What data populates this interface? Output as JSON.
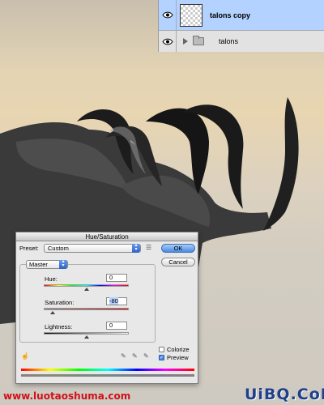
{
  "layers_panel": {
    "layers": [
      {
        "name": "talons copy",
        "selected": true,
        "visible": true,
        "type": "layer"
      },
      {
        "name": "talons",
        "selected": false,
        "visible": true,
        "type": "group"
      }
    ]
  },
  "dialog": {
    "title": "Hue/Saturation",
    "preset_label": "Preset:",
    "preset_value": "Custom",
    "channel_value": "Master",
    "ok_label": "OK",
    "cancel_label": "Cancel",
    "hue": {
      "label": "Hue:",
      "value": "0",
      "level": 0.5
    },
    "saturation": {
      "label": "Saturation:",
      "value": "-80",
      "level": 0.1
    },
    "lightness": {
      "label": "Lightness:",
      "value": "0",
      "level": 0.5
    },
    "colorize": {
      "label": "Colorize",
      "checked": false
    },
    "preview": {
      "label": "Preview",
      "checked": true
    }
  },
  "watermark": {
    "left_text": "www.luotaoshuma.com",
    "right_text": "UiBQ.CoM"
  },
  "colors": {
    "selection": "#b4d2ff",
    "accent": "#4b8be0",
    "watermark_left": "#d0101a",
    "watermark_right": "#1e3f8a"
  }
}
